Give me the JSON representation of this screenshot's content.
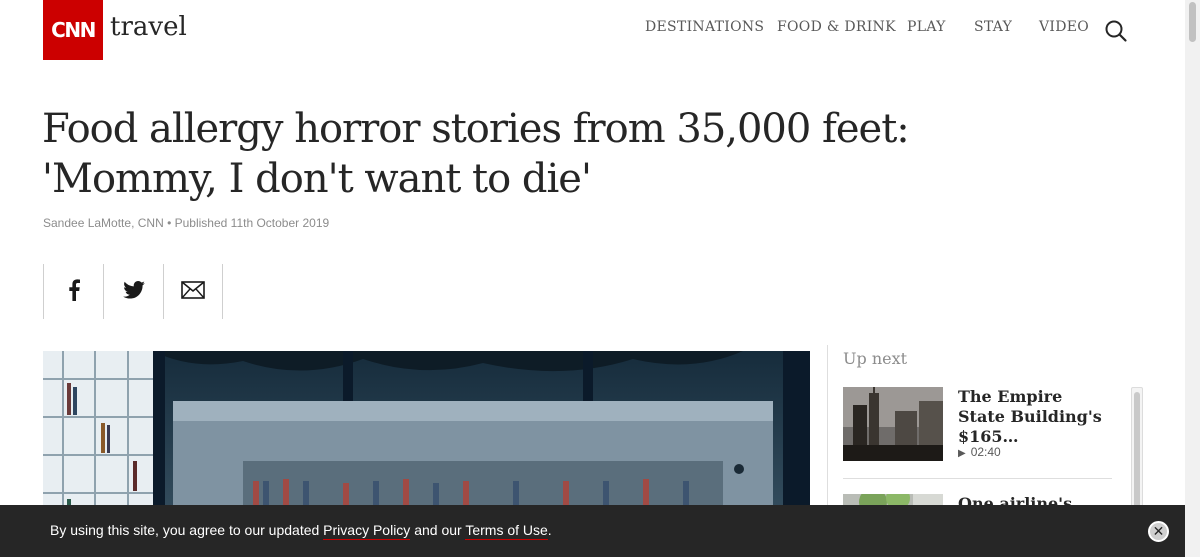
{
  "header": {
    "logo_text": "CNN",
    "section_name": "travel",
    "nav": [
      "DESTINATIONS",
      "FOOD & DRINK",
      "PLAY",
      "STAY",
      "VIDEO"
    ],
    "search_icon": "search-icon"
  },
  "article": {
    "headline_line1": "Food allergy horror stories from 35,000 feet:",
    "headline_line2": "'Mommy, I don't want to die'",
    "author": "Sandee LaMotte, CNN",
    "separator": "•",
    "published": "Published 11th October 2019"
  },
  "share": {
    "icons": [
      "facebook-icon",
      "twitter-icon",
      "email-icon"
    ]
  },
  "sidebar": {
    "heading": "Up next",
    "videos": [
      {
        "title": "The Empire State Building's $165…",
        "duration": "02:40"
      },
      {
        "title": "One airline's",
        "duration": ""
      }
    ]
  },
  "cookie_banner": {
    "text_before": "By using this site, you agree to our updated ",
    "privacy_link": "Privacy Policy",
    "text_middle": " and our ",
    "terms_link": "Terms of Use",
    "text_after": ".",
    "close_icon": "close-icon"
  },
  "colors": {
    "brand_red": "#cc0000",
    "text_dark": "#262626",
    "text_muted": "#8c8c8c",
    "banner_bg": "#262626"
  }
}
